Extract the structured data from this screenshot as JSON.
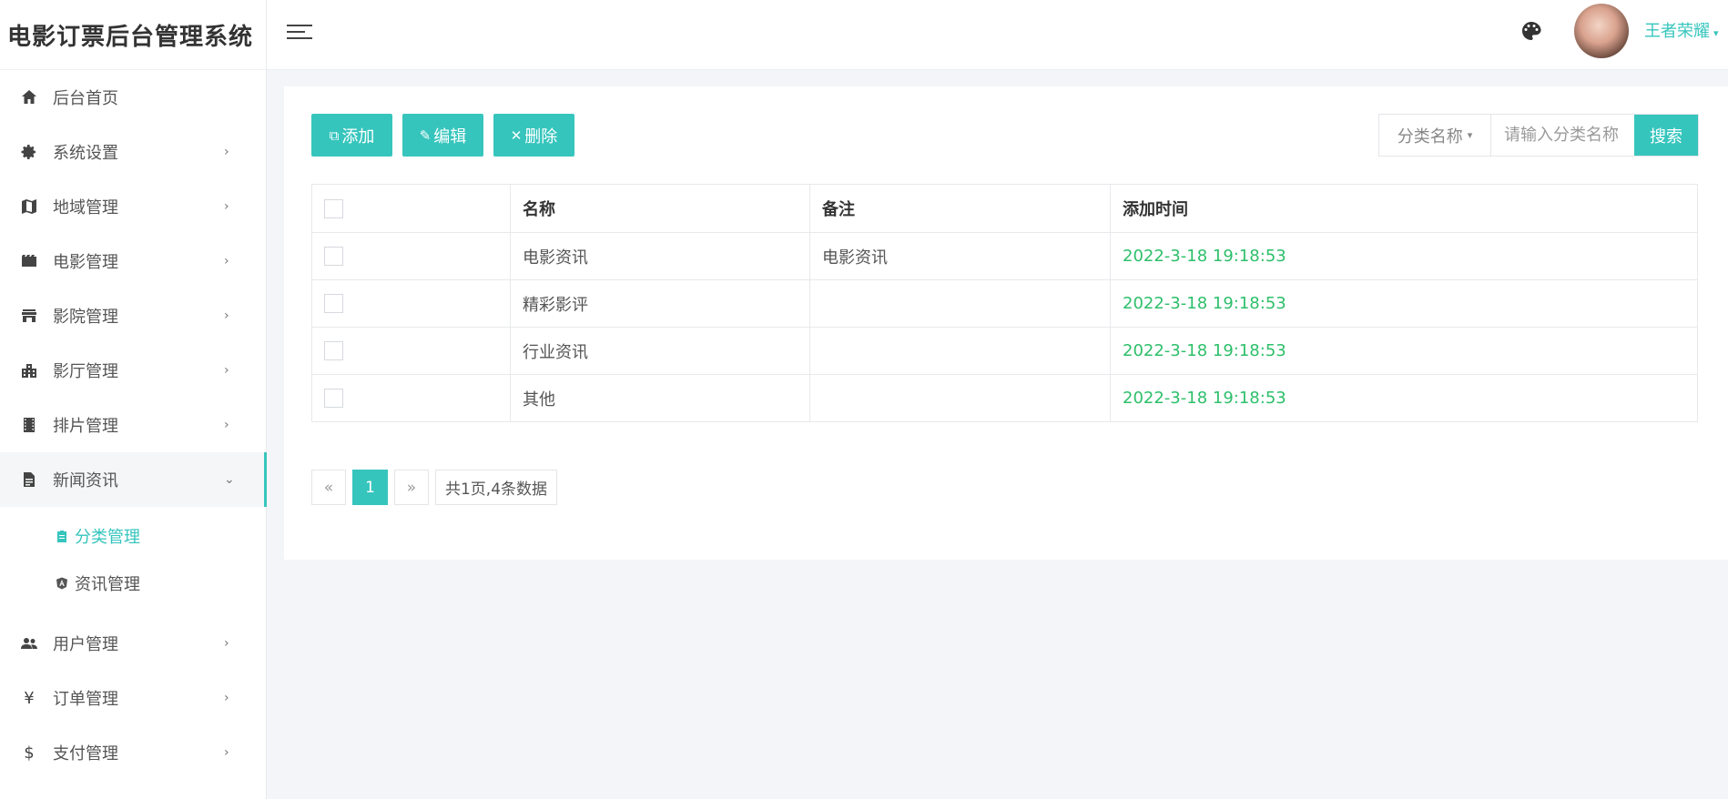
{
  "app": {
    "title": "电影订票后台管理系统"
  },
  "sidebar": {
    "items": [
      {
        "label": "后台首页",
        "icon": "home-icon"
      },
      {
        "label": "系统设置",
        "icon": "gear-icon",
        "chevron": "›"
      },
      {
        "label": "地域管理",
        "icon": "map-icon",
        "chevron": "›"
      },
      {
        "label": "电影管理",
        "icon": "film-icon",
        "chevron": "›"
      },
      {
        "label": "影院管理",
        "icon": "store-icon",
        "chevron": "›"
      },
      {
        "label": "影厅管理",
        "icon": "building-icon",
        "chevron": "›"
      },
      {
        "label": "排片管理",
        "icon": "filmstrip-icon",
        "chevron": "›"
      },
      {
        "label": "新闻资讯",
        "icon": "document-icon",
        "chevron": "⌄"
      }
    ],
    "sub_items": [
      {
        "label": "分类管理",
        "icon": "clipboard-icon",
        "active": true
      },
      {
        "label": "资讯管理",
        "icon": "angular-icon",
        "active": false
      }
    ],
    "items_after": [
      {
        "label": "用户管理",
        "icon": "users-icon",
        "chevron": "›"
      },
      {
        "label": "订单管理",
        "icon": "yen-icon",
        "chevron": "›"
      },
      {
        "label": "支付管理",
        "icon": "dollar-icon",
        "chevron": "›"
      }
    ]
  },
  "header": {
    "username": "王者荣耀",
    "caret": "▾"
  },
  "toolbar": {
    "add_label": "添加",
    "edit_label": "编辑",
    "delete_label": "删除",
    "add_icon": "⧉",
    "edit_icon": "✎",
    "delete_icon": "✕"
  },
  "search": {
    "select_label": "分类名称",
    "caret": "▾",
    "placeholder": "请输入分类名称",
    "button_label": "搜索"
  },
  "table": {
    "headers": [
      "名称",
      "备注",
      "添加时间"
    ],
    "rows": [
      {
        "name": "电影资讯",
        "remark": "电影资讯",
        "time": "2022-3-18 19:18:53"
      },
      {
        "name": "精彩影评",
        "remark": "",
        "time": "2022-3-18 19:18:53"
      },
      {
        "name": "行业资讯",
        "remark": "",
        "time": "2022-3-18 19:18:53"
      },
      {
        "name": "其他",
        "remark": "",
        "time": "2022-3-18 19:18:53"
      }
    ]
  },
  "pagination": {
    "prev": "«",
    "current": "1",
    "next": "»",
    "info": "共1页,4条数据"
  }
}
